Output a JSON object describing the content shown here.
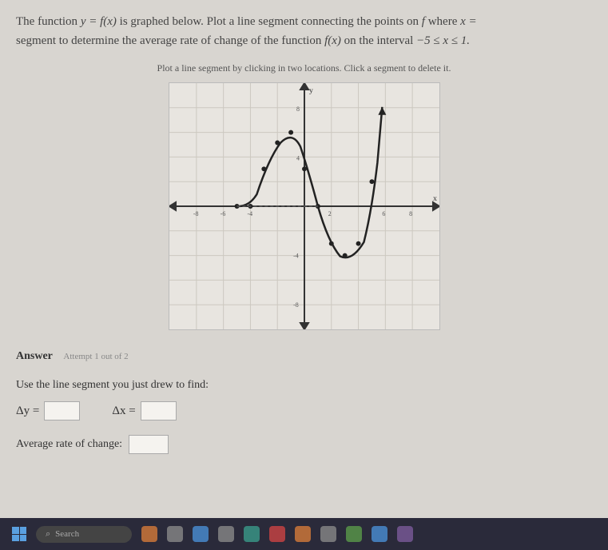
{
  "question": {
    "part1": "The function ",
    "eq1": "y = f(x)",
    "part2": " is graphed below. Plot a line segment connecting the points on ",
    "fvar": "f",
    "part3": " where ",
    "eq2": "x =",
    "part4": "segment to determine the average rate of change of the function ",
    "eq3": "f(x)",
    "part5": " on the interval ",
    "eq4": "−5 ≤ x ≤ 1."
  },
  "instruction": "Plot a line segment by clicking in two locations. Click a segment to delete it.",
  "answer_label": "Answer",
  "attempt_text": "Attempt 1 out of 2",
  "find_text": "Use the line segment you just drew to find:",
  "delta_y_label": "Δy =",
  "delta_x_label": "Δx =",
  "avg_label": "Average rate of change:",
  "search_placeholder": "Search",
  "chart_data": {
    "type": "line",
    "title": "",
    "xlabel": "x",
    "ylabel": "y",
    "xlim": [
      -10,
      10
    ],
    "ylim": [
      -10,
      10
    ],
    "grid": true,
    "series": [
      {
        "name": "f(x)",
        "points": [
          [
            -5,
            0
          ],
          [
            -4,
            0
          ],
          [
            -3,
            3
          ],
          [
            -2,
            6
          ],
          [
            -1,
            6
          ],
          [
            0,
            3
          ],
          [
            1,
            0
          ],
          [
            2,
            -3
          ],
          [
            3,
            -4
          ],
          [
            4,
            -3
          ],
          [
            5,
            2
          ],
          [
            5.5,
            8
          ]
        ]
      },
      {
        "name": "secant",
        "style": "dashed",
        "points": [
          [
            -5,
            0
          ],
          [
            1,
            0
          ]
        ]
      }
    ]
  }
}
